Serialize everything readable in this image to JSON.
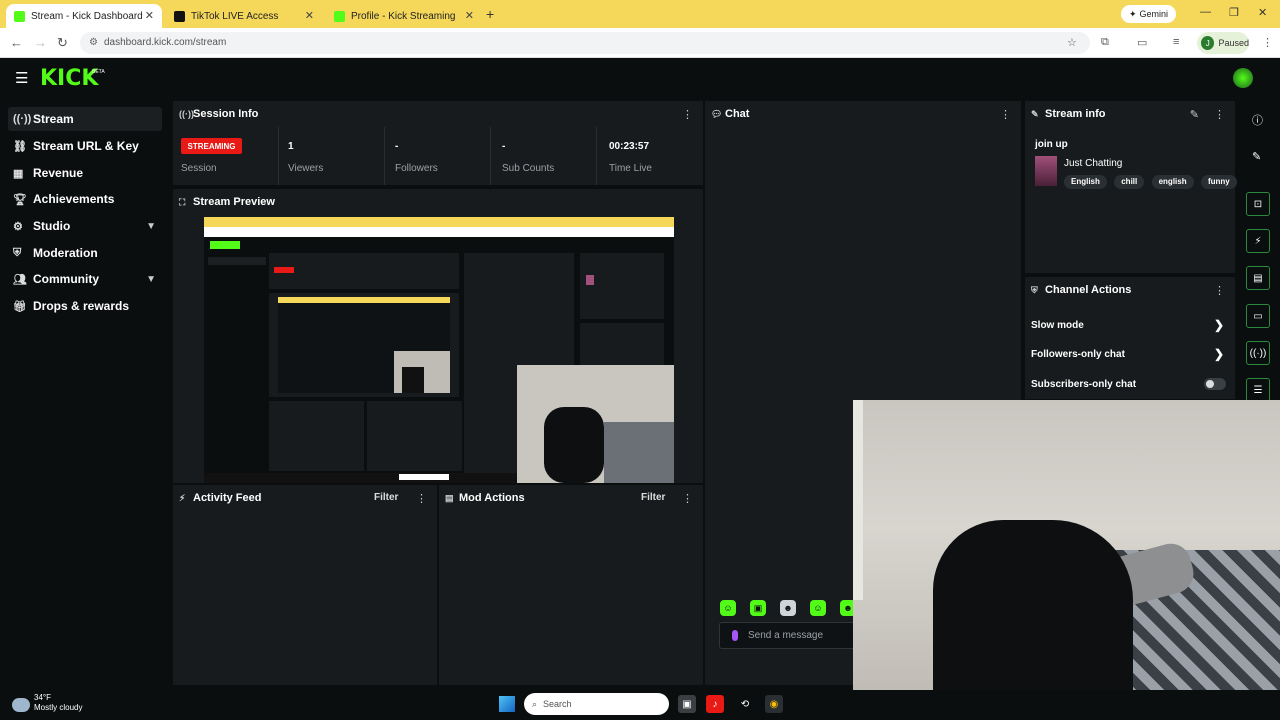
{
  "browser": {
    "tabs": [
      {
        "title": "Stream - Kick Dashboard",
        "favicon_color": "#53fc18",
        "active": true
      },
      {
        "title": "TikTok LIVE Access",
        "favicon_color": "#111111",
        "active": false
      },
      {
        "title": "Profile - Kick Streaming",
        "favicon_color": "#53fc18",
        "active": false
      }
    ],
    "new_tab": "+",
    "gemini_label": "Gemini",
    "url": "dashboard.kick.com/stream",
    "profile_initial": "J",
    "profile_status": "Paused"
  },
  "kick": {
    "logo": "KICK",
    "logo_badge": "BETA"
  },
  "sidebar": {
    "items": [
      {
        "label": "Stream",
        "icon": "stream-icon"
      },
      {
        "label": "Stream URL & Key",
        "icon": "link-icon"
      },
      {
        "label": "Revenue",
        "icon": "revenue-icon"
      },
      {
        "label": "Achievements",
        "icon": "trophy-icon"
      },
      {
        "label": "Studio",
        "icon": "studio-icon"
      },
      {
        "label": "Moderation",
        "icon": "shield-icon"
      },
      {
        "label": "Community",
        "icon": "community-icon"
      },
      {
        "label": "Drops & rewards",
        "icon": "gift-icon"
      }
    ]
  },
  "session": {
    "title": "Session Info",
    "badge": "STREAMING",
    "session_label": "Session",
    "stats": [
      {
        "value": "1",
        "label": "Viewers"
      },
      {
        "value": "-",
        "label": "Followers"
      },
      {
        "value": "-",
        "label": "Sub Counts"
      },
      {
        "value": "00:23:57",
        "label": "Time Live"
      }
    ]
  },
  "preview": {
    "title": "Stream Preview"
  },
  "activity": {
    "title": "Activity Feed",
    "filter": "Filter"
  },
  "mod_actions": {
    "title": "Mod Actions",
    "filter": "Filter"
  },
  "chat": {
    "title": "Chat",
    "placeholder": "Send a message",
    "emote_icons": [
      "emote-1-icon",
      "emote-2-icon",
      "emote-3-icon",
      "emote-4-icon",
      "emote-5-icon"
    ]
  },
  "stream_info": {
    "title": "Stream info",
    "stream_title": "join up",
    "category": "Just Chatting",
    "tags": [
      "English",
      "chill",
      "english",
      "funny"
    ]
  },
  "channel_actions": {
    "title": "Channel Actions",
    "items": [
      {
        "label": "Slow mode"
      },
      {
        "label": "Followers-only chat"
      },
      {
        "label": "Subscribers-only chat"
      }
    ]
  },
  "taskbar": {
    "temperature": "34°F",
    "weather": "Mostly cloudy",
    "search_placeholder": "Search"
  },
  "colors": {
    "kick_green": "#53fc18",
    "streaming_red": "#e91916",
    "panel_bg": "#181b1d",
    "page_bg": "#0b0e0f",
    "tab_bar": "#f5d85a"
  }
}
